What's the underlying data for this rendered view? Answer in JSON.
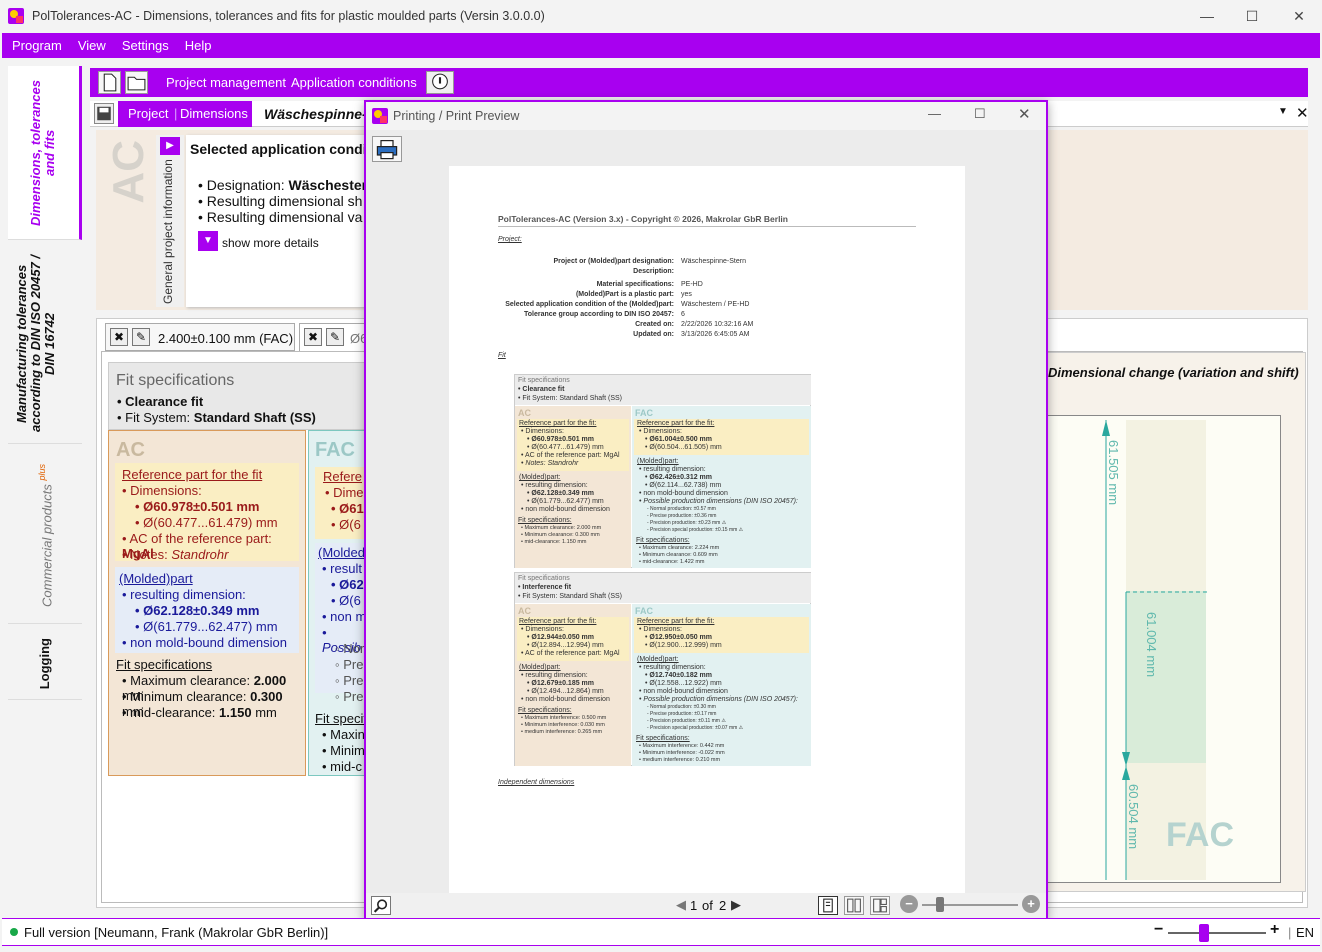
{
  "window": {
    "title": "PolTolerances-AC - Dimensions, tolerances and fits for plastic moulded parts (Versin 3.0.0.0)"
  },
  "menu": [
    "Program",
    "View",
    "Settings",
    "Help"
  ],
  "sidebar": {
    "tabs": [
      {
        "label": "Dimensions, tolerances and fits"
      },
      {
        "label": "Manufacturing tolerances according to DIN ISO 20457 / DIN 16742"
      },
      {
        "label": "Commercial products",
        "badge": "plus"
      },
      {
        "label": "Logging"
      }
    ]
  },
  "toolbar": {
    "project_management": "Project management",
    "application_conditions": "Application conditions"
  },
  "subbar": {
    "project": "Project",
    "dimensions": "Dimensions",
    "part_title": "Wäschespinne-S"
  },
  "general": {
    "strip_label": "General project information",
    "ac_watermark": "AC",
    "panel_title": "Selected application condition",
    "lines": [
      "• Designation: ",
      "• Resulting dimensional sh",
      "• Resulting dimensional va"
    ],
    "designation_value": "Wäschester",
    "show_more": "show more details"
  },
  "dimension_tabs": {
    "tab1": "2.400±0.100 mm (FAC)",
    "tab2": "Ø6"
  },
  "fit": {
    "title": "Fit specifications",
    "line1": "• Clearance fit",
    "line2_prefix": "• Fit System: ",
    "line2_value": "Standard Shaft (SS)"
  },
  "ac": {
    "head": "AC",
    "ref_title": "Reference part for the fit",
    "dimensions": "• Dimensions:",
    "dim_main": "Ø60.978±0.501 mm",
    "dim_range": "Ø(60.477...61.479) mm",
    "ac_ref_prefix": "• AC of the reference part: ",
    "ac_ref_value": "MgAl",
    "notes_prefix": "• Notes: ",
    "notes_value": "Standrohr",
    "molded_title": "(Molded)part",
    "resulting": "• resulting dimension:",
    "res_main": "Ø62.128±0.349 mm",
    "res_range": "Ø(61.779...62.477) mm",
    "non_mold": "• non mold-bound dimension",
    "fit_title": "Fit specifications",
    "max_prefix": "• Maximum clearance: ",
    "max_value": "2.000",
    "min_prefix": "• Minimum clearance: ",
    "min_value": "0.300",
    "mid_prefix": "• mid-clearance: ",
    "mid_value": "1.150",
    "unit": " mm"
  },
  "fac": {
    "head": "FAC",
    "ref_partial": "Refere",
    "dim_partial": "• Dime",
    "v1": "Ø61",
    "v2": "Ø(6",
    "molded_partial": "(Molded",
    "res_partial": "• result",
    "r1": "Ø62",
    "r2": "Ø(6",
    "non_partial": "• non m",
    "poss_partial": "• Possib",
    "p1": "◦ Nor",
    "p2": "◦ Pre",
    "p3": "◦ Pre",
    "p4": "◦ Pre",
    "fit_partial": "Fit specif",
    "f1": "• Maxin",
    "f2": "• Minim",
    "f3": "• mid-c"
  },
  "right_panel": {
    "title": "Dimensional change (variation and shift)",
    "label_top": "61.505 mm",
    "label_mid": "61.004 mm",
    "label_bottom": "60.504 mm",
    "watermark": "FAC"
  },
  "dialog": {
    "title": "Printing / Print Preview",
    "page_current": "1",
    "page_of": "of",
    "page_total": "2"
  },
  "preview": {
    "header": "PolTolerances-AC (Version 3.x) - Copyright © 2026, Makrolar GbR Berlin",
    "project_heading": "Project:",
    "rows": [
      {
        "k": "Project or (Molded)part designation:",
        "v": "Wäschespinne-Stern"
      },
      {
        "k": "Description:",
        "v": ""
      },
      {
        "k": "Material specifications:",
        "v": "PE-HD"
      },
      {
        "k": "(Molded)Part is a plastic part:",
        "v": "yes"
      },
      {
        "k": "Selected application condition of the (Molded)part:",
        "v": "Wäschestern / PE-HD"
      },
      {
        "k": "Tolerance group according to DIN ISO 20457:",
        "v": "6"
      },
      {
        "k": "Created on:",
        "v": "2/22/2026 10:32:16 AM"
      },
      {
        "k": "Updated on:",
        "v": "3/13/2026 6:45:05 AM"
      }
    ],
    "fit_heading": "Fit",
    "independent": "Independent dimensions",
    "blocks": [
      {
        "fs_title": "Fit specifications",
        "fit_type": "• Clearance fit",
        "fit_system": "• Fit System: Standard Shaft (SS)",
        "ac_ref": "Reference part for the fit:",
        "ac_dims": "• Dimensions:",
        "ac_d1": "• Ø60.978±0.501 mm",
        "ac_d2": "• Ø(60.477...61.479) mm",
        "ac_acref": "• AC of the reference part: MgAl",
        "ac_notes": "• Notes: Standrohr",
        "ac_mold": "(Molded)part:",
        "ac_res": "• resulting dimension:",
        "ac_r1": "• Ø62.128±0.349 mm",
        "ac_r2": "• Ø(61.779...62.477) mm",
        "ac_non": "• non mold-bound dimension",
        "ac_fs": "Fit specifications:",
        "ac_f1": "• Maximum clearance: 2.000 mm",
        "ac_f2": "• Minimum clearance: 0.300 mm",
        "ac_f3": "• mid-clearance: 1.150 mm",
        "fac_ref": "Reference part for the fit:",
        "fac_dims": "• Dimensions:",
        "fac_d1": "• Ø61.004±0.500 mm",
        "fac_d2": "• Ø(60.504...61.505) mm",
        "fac_mold": "(Molded)part:",
        "fac_res": "• resulting dimension:",
        "fac_r1": "• Ø62.426±0.312 mm",
        "fac_r2": "• Ø(62.114...62.738) mm",
        "fac_non": "• non mold-bound dimension",
        "fac_poss": "• Possible production dimensions (DIN ISO 20457):",
        "fac_p1": "- Normal production: ±0.57 mm",
        "fac_p2": "- Precise production: ±0.36 mm",
        "fac_p3": "- Precision production: ±0.23 mm ⚠",
        "fac_p4": "- Precision special production: ±0.15 mm ⚠",
        "fac_fs": "Fit specifications:",
        "fac_f1": "• Maximum clearance: 2.224 mm",
        "fac_f2": "• Minimum clearance: 0.609 mm",
        "fac_f3": "• mid-clearance: 1.422 mm"
      },
      {
        "fs_title": "Fit specifications",
        "fit_type": "• Interference fit",
        "fit_system": "• Fit System: Standard Shaft (SS)",
        "ac_ref": "Reference part for the fit:",
        "ac_dims": "• Dimensions:",
        "ac_d1": "• Ø12.944±0.050 mm",
        "ac_d2": "• Ø(12.894...12.994) mm",
        "ac_acref": "• AC of the reference part: MgAl",
        "ac_notes": "",
        "ac_mold": "(Molded)part:",
        "ac_res": "• resulting dimension:",
        "ac_r1": "• Ø12.679±0.185 mm",
        "ac_r2": "• Ø(12.494...12.864) mm",
        "ac_non": "• non mold-bound dimension",
        "ac_fs": "Fit specifications:",
        "ac_f1": "• Maximum interference: 0.500 mm",
        "ac_f2": "• Minimum interference: 0.030 mm",
        "ac_f3": "• medium interference: 0.265 mm",
        "fac_ref": "Reference part for the fit:",
        "fac_dims": "• Dimensions:",
        "fac_d1": "• Ø12.950±0.050 mm",
        "fac_d2": "• Ø(12.900...12.999) mm",
        "fac_mold": "(Molded)part:",
        "fac_res": "• resulting dimension:",
        "fac_r1": "• Ø12.740±0.182 mm",
        "fac_r2": "• Ø(12.558...12.922) mm",
        "fac_non": "• non mold-bound dimension",
        "fac_poss": "• Possible production dimensions (DIN ISO 20457):",
        "fac_p1": "- Normal production: ±0.30 mm",
        "fac_p2": "- Precise production: ±0.17 mm",
        "fac_p3": "- Precision production: ±0.11 mm ⚠",
        "fac_p4": "- Precision special production: ±0.07 mm ⚠",
        "fac_fs": "Fit specifications:",
        "fac_f1": "• Maximum interference: 0.442 mm",
        "fac_f2": "• Minimum interference: -0.022 mm",
        "fac_f3": "• medium interference: 0.210 mm"
      }
    ]
  },
  "status": {
    "text": "Full version [Neumann, Frank (Makrolar GbR Berlin)]",
    "lang": "EN",
    "zoom_percent": 45
  },
  "colors": {
    "accent": "#a800f0",
    "ac_bg": "#f3e6d6",
    "fac_bg": "#e2f1f1",
    "ref_bg": "#faeec3"
  }
}
